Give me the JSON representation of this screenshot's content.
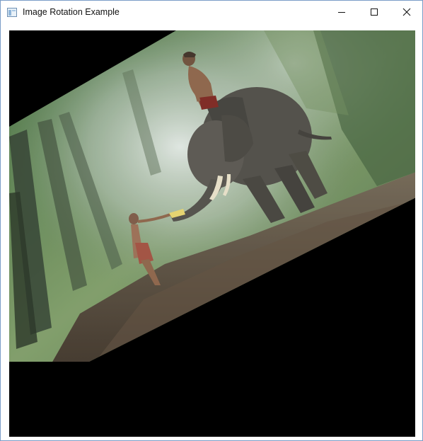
{
  "window": {
    "title": "Image Rotation Example",
    "controls": {
      "minimize_icon": "minimize-icon",
      "maximize_icon": "maximize-icon",
      "close_icon": "close-icon"
    }
  },
  "colors": {
    "canvas_background": "#000000",
    "window_border": "#7a9cc7"
  },
  "image": {
    "subject": "boy feeding a bottle to an elephant carrying a rider in a misty forest",
    "rotation_degrees": -30
  }
}
